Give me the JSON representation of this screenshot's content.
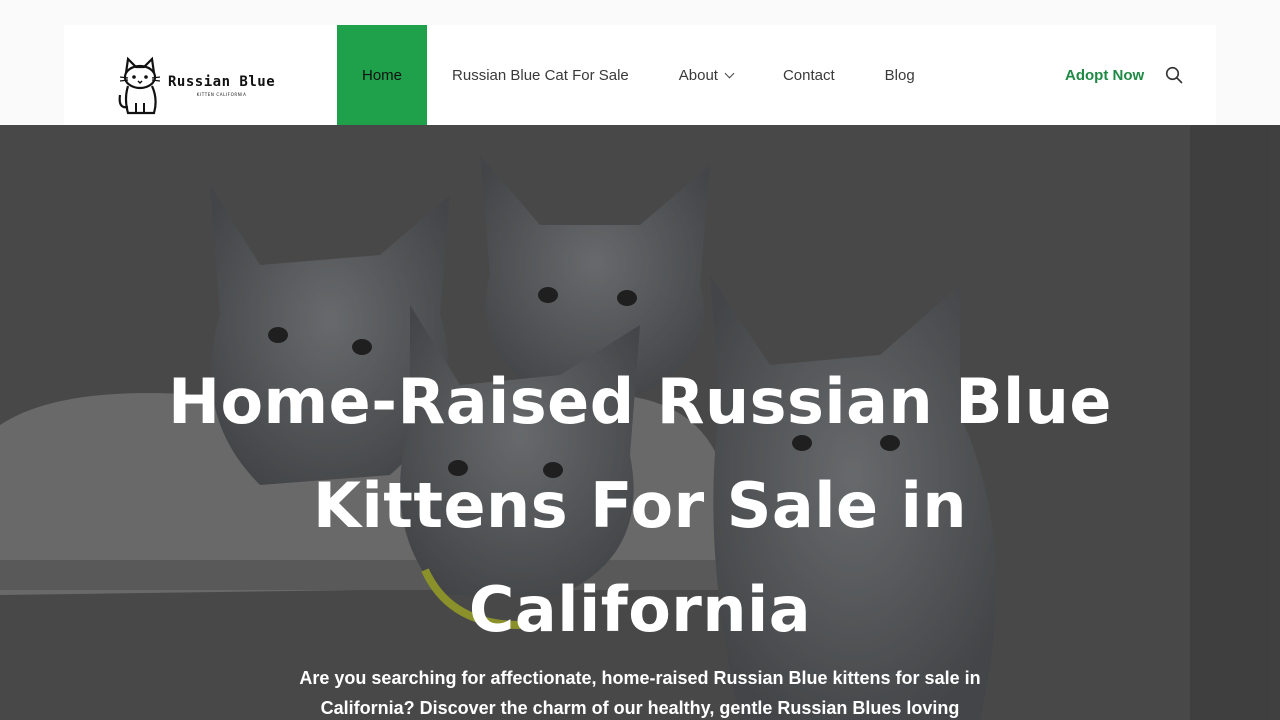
{
  "brand": {
    "title": "Russian Blue",
    "subtitle": "KITTEN CALIFORNIA"
  },
  "nav": {
    "items": [
      {
        "label": "Home"
      },
      {
        "label": "Russian Blue Cat For Sale"
      },
      {
        "label": "About"
      },
      {
        "label": "Contact"
      },
      {
        "label": "Blog"
      }
    ],
    "cta": "Adopt Now"
  },
  "hero": {
    "title": "Home-Raised Russian Blue Kittens For Sale in California",
    "text": "Are you searching for affectionate, home-raised Russian Blue kittens for sale in California? Discover the charm of our healthy, gentle Russian Blues loving"
  },
  "colors": {
    "accent": "#1fa04a",
    "cta": "#1f8a45"
  },
  "icons": {
    "search": "search-icon",
    "chevron": "chevron-down-icon",
    "logo": "cat-logo-icon"
  }
}
